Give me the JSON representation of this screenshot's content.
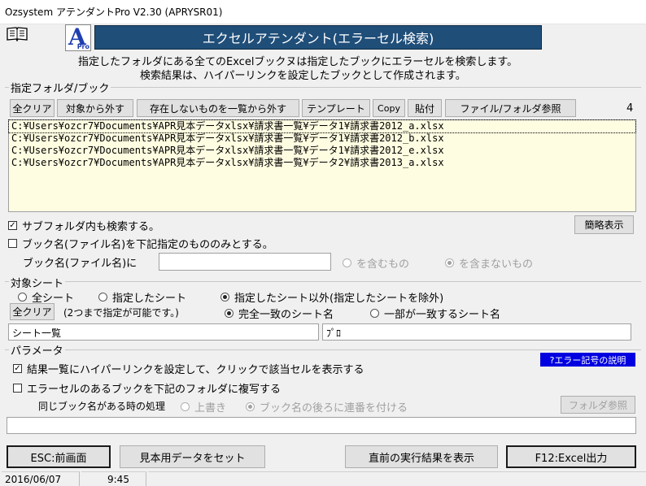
{
  "window": {
    "title": "Ozsystem アテンダントPro V2.30 (APRYSR01)"
  },
  "header": {
    "banner": "エクセルアテンダント(エラーセル検索)",
    "logo_letter": "A",
    "logo_sub": "Pro",
    "desc1": "指定したフォルダにある全てのExcelブックヌは指定したブックにエラーセルを検索します。",
    "desc2": "検索結果は、ハイパーリンクを設定したブックとして作成されます。"
  },
  "folder_group": {
    "label": "指定フォルダ/ブック",
    "buttons": {
      "clear_all": "全クリア",
      "exclude": "対象から外す",
      "remove_missing": "存在しないものを一覧から外す",
      "template": "テンプレート",
      "copy": "Copy",
      "paste": "貼付",
      "browse": "ファイル/フォルダ参照"
    },
    "count": "4",
    "files": [
      "C:¥Users¥ozcr7¥Documents¥APR見本データxlsx¥請求書一覧¥データ1¥請求書2012_a.xlsx",
      "C:¥Users¥ozcr7¥Documents¥APR見本データxlsx¥請求書一覧¥データ1¥請求書2012_b.xlsx",
      "C:¥Users¥ozcr7¥Documents¥APR見本データxlsx¥請求書一覧¥データ1¥請求書2012_e.xlsx",
      "C:¥Users¥ozcr7¥Documents¥APR見本データxlsx¥請求書一覧¥データ2¥請求書2013_a.xlsx"
    ],
    "subfolder_check": "サブフォルダ内も検索する。",
    "simple_view": "簡略表示",
    "book_name_check": "ブック名(ファイル名)を下記指定のもののみとする。",
    "book_name_label": "ブック名(ファイル名)に",
    "book_name_value": "",
    "contains": "を含むもの",
    "not_contains": "を含まないもの"
  },
  "sheet_group": {
    "label": "対象シート",
    "all_sheets": "全シート",
    "specified": "指定したシート",
    "except_specified": "指定したシート以外(指定したシートを除外)",
    "clear_all": "全クリア",
    "note": "(2つまで指定が可能です。)",
    "exact_match": "完全一致のシート名",
    "partial_match": "一部が一致するシート名",
    "sheet1": "シート一覧",
    "sheet2": "ﾌﾟﾛ"
  },
  "param_group": {
    "label": "パラメータ",
    "hyperlink_check": "結果一覧にハイパーリンクを設定して、クリックで該当セルを表示する",
    "error_help": "?エラー記号の説明",
    "copy_check": "エラーセルのあるブックを下記のフォルダに複写する",
    "same_name_label": "同じブック名がある時の処理",
    "overwrite": "上書き",
    "append_number": "ブック名の後ろに連番を付ける",
    "folder_browse": "フォルダ参照",
    "folder_path": ""
  },
  "footer": {
    "esc": "ESC:前画面",
    "sample": "見本用データをセット",
    "prev_result": "直前の実行結果を表示",
    "f12": "F12:Excel出力"
  },
  "statusbar": {
    "date": "2016/06/07",
    "time": "9:45"
  },
  "colors": {
    "banner_bg": "#1f4e79",
    "help_bg": "#0000e0"
  }
}
